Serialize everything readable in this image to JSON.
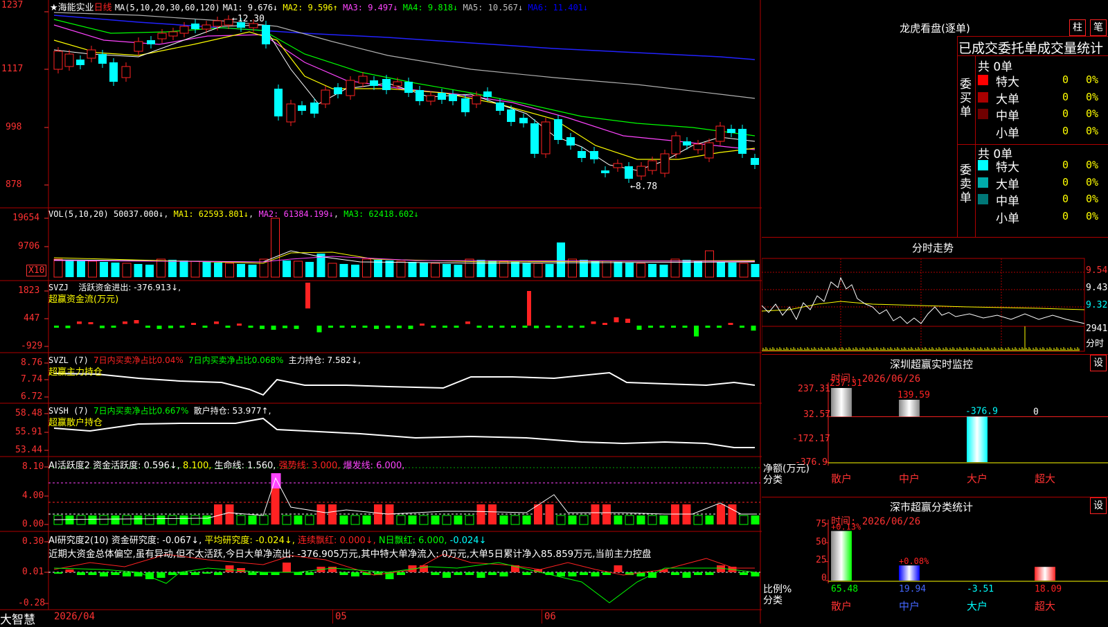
{
  "stock": {
    "name": "海能实业",
    "period": "日线",
    "star": "★"
  },
  "kline": {
    "ma_title": "MA(5,10,20,30,60,120)",
    "ma_values": [
      {
        "label": "MA1: 9.676↓",
        "color": "#ffffff"
      },
      {
        "label": "MA2: 9.596↑",
        "color": "#ffff00"
      },
      {
        "label": "MA3: 9.497↓",
        "color": "#ff44ff"
      },
      {
        "label": "MA4: 9.818↓",
        "color": "#00ff00"
      },
      {
        "label": "MA5: 10.567↓",
        "color": "#c0c0c0"
      },
      {
        "label": "MA6: 11.401↓",
        "color": "#0000ff"
      }
    ],
    "yticks": [
      "1237",
      "1117",
      "998",
      "878"
    ],
    "high_mark": "12.30",
    "low_mark": "8.78"
  },
  "vol": {
    "title": "VOL(5,10,20)",
    "value": "50037.000↓",
    "ma1": "MA1: 62593.801↓",
    "ma2": "MA2: 61384.199↓",
    "ma3": "MA3: 62418.602↓",
    "yticks": [
      "19654",
      "9706"
    ],
    "unit": "X10"
  },
  "svzj": {
    "title": "SVZJ",
    "line": "活跃资金进出: -376.913↓,",
    "sub": "超赢资金流(万元)",
    "yticks": [
      "1823",
      "447",
      "-929"
    ]
  },
  "svzl": {
    "title": "SVZL (7)",
    "a": "7日内买卖净占比0.04%",
    "b": "7日内买卖净占比0.068%",
    "c": "主力持仓: 7.582↓,",
    "sub": "超赢主力持仓",
    "yticks": [
      "8.76",
      "7.74",
      "6.72"
    ]
  },
  "svsh": {
    "title": "SVSH (7)",
    "a": "7日内买卖净占比0.667%",
    "c": "散户持仓: 53.977↑,",
    "sub": "超赢散户持仓",
    "yticks": [
      "58.48",
      "55.91",
      "53.44"
    ]
  },
  "ai1": {
    "title": "AI活跃度2",
    "a": "资金活跃度: 0.596↓,",
    "b": "8.100,",
    "c": "生命线: 1.560,",
    "d": "强势线: 3.000,",
    "e": "爆发线: 6.000,",
    "yticks": [
      "8.10",
      "4.00",
      "0.00"
    ]
  },
  "ai2": {
    "title": "AI研究度2(10)",
    "a": "资金研究度: -0.067↓,",
    "b": "平均研究度: -0.024↓,",
    "c": "连续飘红: 0.000↓,",
    "d": "N日飘红: 6.000,",
    "e": "-0.024↓",
    "yticks": [
      "0.30",
      "0.01",
      "-0.28"
    ],
    "comment": "近期大资金总体偏空,虽有异动,但不太活跃,今日大单净流出: -376.905万元,其中特大单净流入: 0万元,大单5日累计净入85.859万元,当前主力控盘"
  },
  "xaxis": {
    "labels": [
      "2026/04",
      "05",
      "06"
    ],
    "brand": "大智慧"
  },
  "longhu": {
    "title": "龙虎看盘(逐单)",
    "btn1": "柱",
    "btn2": "笔",
    "tabs": [
      "已成交",
      "委托单",
      "成交量统计"
    ],
    "buy": {
      "side": "委买单",
      "total": "共 0单",
      "rows": [
        {
          "label": "特大",
          "count": "0",
          "pct": "0%",
          "color": "#ff0000"
        },
        {
          "label": "大单",
          "count": "0",
          "pct": "0%",
          "color": "#aa0000"
        },
        {
          "label": "中单",
          "count": "0",
          "pct": "0%",
          "color": "#700000"
        },
        {
          "label": "小单",
          "count": "0",
          "pct": "0%",
          "color": "#000000"
        }
      ]
    },
    "sell": {
      "side": "委卖单",
      "total": "共 0单",
      "rows": [
        {
          "label": "特大",
          "count": "0",
          "pct": "0%",
          "color": "#00ffff"
        },
        {
          "label": "大单",
          "count": "0",
          "pct": "0%",
          "color": "#00aaaa"
        },
        {
          "label": "中单",
          "count": "0",
          "pct": "0%",
          "color": "#007777"
        },
        {
          "label": "小单",
          "count": "0",
          "pct": "0%",
          "color": "#000000"
        }
      ]
    }
  },
  "fenshi": {
    "title": "分时走势",
    "yticks": [
      "9.54",
      "9.43",
      "9.32"
    ],
    "vol_label": "2941",
    "unit": "分时"
  },
  "monitor": {
    "title": "深圳超赢实时监控",
    "btn": "设",
    "time": "时间: 2026/06/26",
    "yticks": [
      "237.31",
      "32.57",
      "-172.17",
      "-376.9"
    ],
    "ylabel1": "净额(万元)",
    "ylabel2": "分类",
    "categories": [
      "散户",
      "中户",
      "大户",
      "超大"
    ],
    "values": [
      "237.31",
      "139.59",
      "-376.9",
      "0"
    ]
  },
  "classstat": {
    "title": "深市超赢分类统计",
    "btn": "设",
    "time": "时间: 2026/06/26",
    "yticks": [
      "75",
      "50",
      "25",
      "0"
    ],
    "ylabel1": "比例%",
    "ylabel2": "分类",
    "categories": [
      "散户",
      "中户",
      "大户",
      "超大"
    ],
    "top": [
      "+0.13%",
      "+0.08%",
      "",
      ""
    ],
    "values": [
      "65.48",
      "19.94",
      "-3.51",
      "18.09"
    ]
  },
  "chart_data": [
    {
      "type": "bar",
      "title": "深圳超赢实时监控",
      "categories": [
        "散户",
        "中户",
        "大户",
        "超大"
      ],
      "values": [
        237.31,
        139.59,
        -376.9,
        0
      ],
      "ylabel": "净额(万元)",
      "ylim": [
        -376.9,
        237.31
      ]
    },
    {
      "type": "bar",
      "title": "深市超赢分类统计",
      "categories": [
        "散户",
        "中户",
        "大户",
        "超大"
      ],
      "values": [
        65.48,
        19.94,
        -3.51,
        18.09
      ],
      "ylabel": "比例%",
      "ylim": [
        0,
        75
      ]
    }
  ]
}
